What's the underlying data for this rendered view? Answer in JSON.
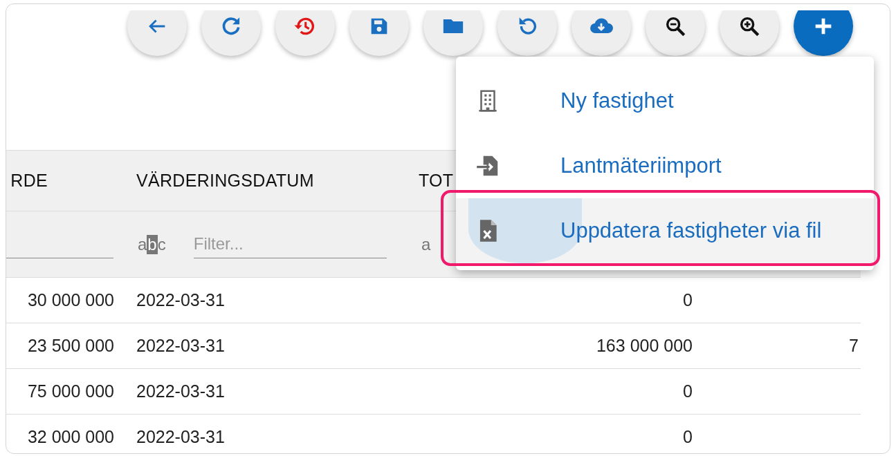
{
  "table": {
    "columns": [
      {
        "label": "RDE",
        "filter": {
          "kind": "field"
        }
      },
      {
        "label": "VÄRDERINGSDATUM",
        "filter": {
          "kind": "icon-field",
          "type_badge": "abc",
          "placeholder": "Filter..."
        }
      },
      {
        "label": "TOT",
        "filter": {
          "kind": "icon-only",
          "type_badge": "a"
        }
      },
      {}
    ],
    "rows": [
      {
        "cells": [
          "30 000 000",
          "2022-03-31",
          "0",
          null
        ]
      },
      {
        "cells": [
          "23 500 000",
          "2022-03-31",
          "163 000 000",
          "7"
        ]
      },
      {
        "cells": [
          "75 000 000",
          "2022-03-31",
          "0",
          null
        ]
      },
      {
        "cells": [
          "32 000 000",
          "2022-03-31",
          "0",
          null
        ]
      }
    ]
  },
  "menu": {
    "items": [
      {
        "label": "Ny fastighet",
        "kind": "building",
        "highlighted": false,
        "annotated": false
      },
      {
        "label": "Lantmäteriimport",
        "kind": "import",
        "highlighted": false,
        "annotated": false
      },
      {
        "label": "Uppdatera fastigheter via fil",
        "kind": "excel",
        "highlighted": true,
        "annotated": true
      }
    ]
  }
}
